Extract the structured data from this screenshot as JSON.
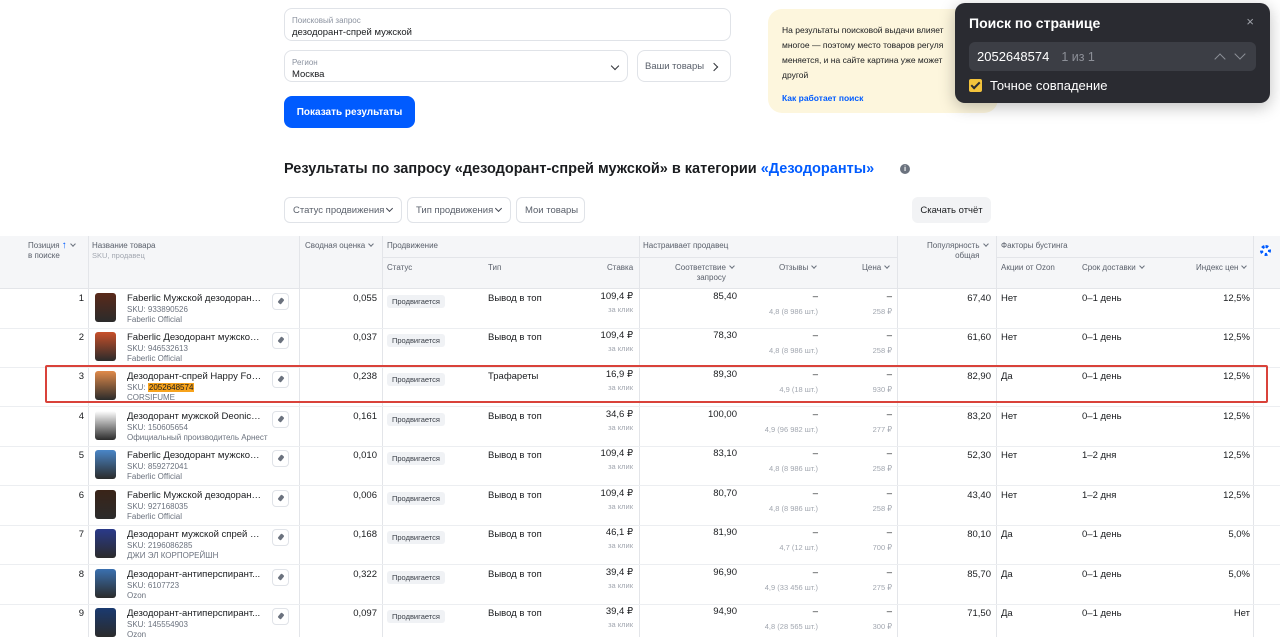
{
  "search": {
    "query_label": "Поисковый запрос",
    "query_value": "дезодорант-спрей мужской",
    "region_label": "Регион",
    "region_value": "Москва",
    "my_goods_label": "Ваши товары",
    "show_results_label": "Показать результаты"
  },
  "info": {
    "text": "На результаты поисковой выдачи влияет многое — поэтому место товаров регуля меняется, и на сайте картина уже может другой",
    "link": "Как работает поиск"
  },
  "find": {
    "title": "Поиск по странице",
    "close": "×",
    "query": "2052648574",
    "count": "1 из 1",
    "exact_label": "Точное совпадение",
    "exact_checked": true
  },
  "results": {
    "title_prefix": "Результаты по запросу «дезодорант-спрей мужской» в категории ",
    "category": "«Дезодоранты»",
    "info_icon": "i"
  },
  "filters": {
    "status": "Статус продвижения",
    "type": "Тип продвижения",
    "my_goods": "Мои товары",
    "download": "Скачать отчёт"
  },
  "table": {
    "headers": {
      "position": "Позиция",
      "position_sub": "в поиске",
      "name": "Название товара",
      "name_sub": "SKU, продавец",
      "score": "Сводная оценка",
      "promotion": "Продвижение",
      "status": "Статус",
      "type": "Тип",
      "bid": "Ставка",
      "seller_sets": "Настраивает продавец",
      "relevance": "Соответствие",
      "relevance_sub": "запросу",
      "reviews": "Отзывы",
      "price": "Цена",
      "popularity": "Популярность",
      "popularity_sub": "общая",
      "boost": "Факторы бустинга",
      "ozon_actions": "Акции от Ozon",
      "delivery": "Срок доставки",
      "price_index": "Индекс цен"
    },
    "rows": [
      {
        "pos": "1",
        "name": "Faberlic Мужской дезодорант,...",
        "sku_prefix": "SKU: ",
        "sku": "933890526",
        "seller": "Faberlic Official",
        "score": "0,055",
        "status": "Продвигается",
        "type": "Вывод в топ",
        "bid": "109,4 ₽",
        "bid_sub": "за клик",
        "relevance": "85,40",
        "reviews": "–",
        "reviews_sub": "4,8 (8 986 шт.)",
        "price": "–",
        "price_sub": "258 ₽",
        "popularity": "67,40",
        "actions": "Нет",
        "delivery": "0–1 день",
        "index": "12,5%",
        "thumb": "#5a2a1a"
      },
      {
        "pos": "2",
        "name": "Faberlic Дезодорант мужской,...",
        "sku_prefix": "SKU: ",
        "sku": "946532613",
        "seller": "Faberlic Official",
        "score": "0,037",
        "status": "Продвигается",
        "type": "Вывод в топ",
        "bid": "109,4 ₽",
        "bid_sub": "за клик",
        "relevance": "78,30",
        "reviews": "–",
        "reviews_sub": "4,8 (8 986 шт.)",
        "price": "–",
        "price_sub": "258 ₽",
        "popularity": "61,60",
        "actions": "Нет",
        "delivery": "0–1 день",
        "index": "12,5%",
        "thumb": "#c8502a"
      },
      {
        "pos": "3",
        "name": "Дезодорант-спрей Happy For...",
        "sku_prefix": "SKU: ",
        "sku": "2052648574",
        "seller": "CORSIFUME",
        "score": "0,238",
        "status": "Продвигается",
        "type": "Трафареты",
        "bid": "16,9 ₽",
        "bid_sub": "за клик",
        "relevance": "89,30",
        "reviews": "–",
        "reviews_sub": "4,9 (18 шт.)",
        "price": "–",
        "price_sub": "930 ₽",
        "popularity": "82,90",
        "actions": "Да",
        "delivery": "0–1 день",
        "index": "12,5%",
        "thumb": "#e08a4a"
      },
      {
        "pos": "4",
        "name": "Дезодорант мужской Deonica...",
        "sku_prefix": "SKU: ",
        "sku": "150605654",
        "seller": "Официальный производитель Арнест",
        "score": "0,161",
        "status": "Продвигается",
        "type": "Вывод в топ",
        "bid": "34,6 ₽",
        "bid_sub": "за клик",
        "relevance": "100,00",
        "reviews": "–",
        "reviews_sub": "4,9 (96 982 шт.)",
        "price": "–",
        "price_sub": "277 ₽",
        "popularity": "83,20",
        "actions": "Нет",
        "delivery": "0–1 день",
        "index": "12,5%",
        "thumb": "#ffffff"
      },
      {
        "pos": "5",
        "name": "Faberlic Дезодорант мужской,...",
        "sku_prefix": "SKU: ",
        "sku": "859272041",
        "seller": "Faberlic Official",
        "score": "0,010",
        "status": "Продвигается",
        "type": "Вывод в топ",
        "bid": "109,4 ₽",
        "bid_sub": "за клик",
        "relevance": "83,10",
        "reviews": "–",
        "reviews_sub": "4,8 (8 986 шт.)",
        "price": "–",
        "price_sub": "258 ₽",
        "popularity": "52,30",
        "actions": "Нет",
        "delivery": "1–2 дня",
        "index": "12,5%",
        "thumb": "#4a86c8"
      },
      {
        "pos": "6",
        "name": "Faberlic Мужской дезодорант,...",
        "sku_prefix": "SKU: ",
        "sku": "927168035",
        "seller": "Faberlic Official",
        "score": "0,006",
        "status": "Продвигается",
        "type": "Вывод в топ",
        "bid": "109,4 ₽",
        "bid_sub": "за клик",
        "relevance": "80,70",
        "reviews": "–",
        "reviews_sub": "4,8 (8 986 шт.)",
        "price": "–",
        "price_sub": "258 ₽",
        "popularity": "43,40",
        "actions": "Нет",
        "delivery": "1–2 дня",
        "index": "12,5%",
        "thumb": "#3a2418"
      },
      {
        "pos": "7",
        "name": "Дезодорант мужской спрей 4...",
        "sku_prefix": "SKU: ",
        "sku": "2196086285",
        "seller": "ДЖИ ЭЛ КОРПОРЕЙШН",
        "score": "0,168",
        "status": "Продвигается",
        "type": "Вывод в топ",
        "bid": "46,1 ₽",
        "bid_sub": "за клик",
        "relevance": "81,90",
        "reviews": "–",
        "reviews_sub": "4,7 (12 шт.)",
        "price": "–",
        "price_sub": "700 ₽",
        "popularity": "80,10",
        "actions": "Да",
        "delivery": "0–1 день",
        "index": "5,0%",
        "thumb": "#2a3a8a"
      },
      {
        "pos": "8",
        "name": "Дезодорант-антиперспирант...",
        "sku_prefix": "SKU: ",
        "sku": "6107723",
        "seller": "Ozon",
        "score": "0,322",
        "status": "Продвигается",
        "type": "Вывод в топ",
        "bid": "39,4 ₽",
        "bid_sub": "за клик",
        "relevance": "96,90",
        "reviews": "–",
        "reviews_sub": "4,9 (33 456 шт.)",
        "price": "–",
        "price_sub": "275 ₽",
        "popularity": "85,70",
        "actions": "Да",
        "delivery": "0–1 день",
        "index": "5,0%",
        "thumb": "#3a70b0"
      },
      {
        "pos": "9",
        "name": "Дезодорант-антиперспирант...",
        "sku_prefix": "SKU: ",
        "sku": "145554903",
        "seller": "Ozon",
        "score": "0,097",
        "status": "Продвигается",
        "type": "Вывод в топ",
        "bid": "39,4 ₽",
        "bid_sub": "за клик",
        "relevance": "94,90",
        "reviews": "–",
        "reviews_sub": "4,8 (28 565 шт.)",
        "price": "–",
        "price_sub": "300 ₽",
        "popularity": "71,50",
        "actions": "Да",
        "delivery": "0–1 день",
        "index": "Нет",
        "thumb": "#1a3a70"
      }
    ]
  },
  "colors": {
    "accent": "#005bff",
    "highlight": "#f7a31c",
    "selection_frame": "#d9423a",
    "find_panel_bg": "#2a2b31"
  }
}
